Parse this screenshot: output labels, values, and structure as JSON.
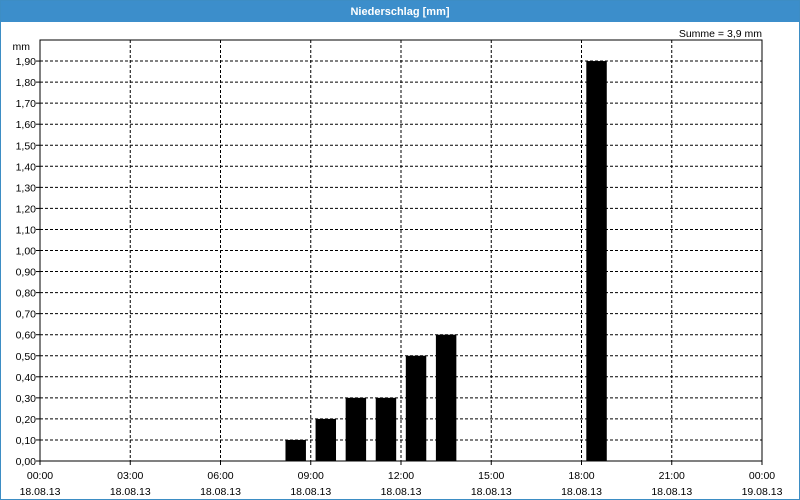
{
  "window": {
    "title": "Niederschlag [mm]"
  },
  "chart_data": {
    "type": "bar",
    "title": "Niederschlag [mm]",
    "ylabel": "mm",
    "annotation": "Summe = 3,9 mm",
    "ylim": [
      0,
      2.0
    ],
    "y_ticks": [
      "0,00",
      "0,10",
      "0,20",
      "0,30",
      "0,40",
      "0,50",
      "0,60",
      "0,70",
      "0,80",
      "0,90",
      "1,00",
      "1,10",
      "1,20",
      "1,30",
      "1,40",
      "1,50",
      "1,60",
      "1,70",
      "1,80",
      "1,90"
    ],
    "xlim_hours": [
      0,
      24
    ],
    "x_ticks": [
      {
        "time": "00:00",
        "date": "18.08.13"
      },
      {
        "time": "03:00",
        "date": "18.08.13"
      },
      {
        "time": "06:00",
        "date": "18.08.13"
      },
      {
        "time": "09:00",
        "date": "18.08.13"
      },
      {
        "time": "12:00",
        "date": "18.08.13"
      },
      {
        "time": "15:00",
        "date": "18.08.13"
      },
      {
        "time": "18:00",
        "date": "18.08.13"
      },
      {
        "time": "21:00",
        "date": "18.08.13"
      },
      {
        "time": "00:00",
        "date": "19.08.13"
      }
    ],
    "bars": [
      {
        "hour": 8,
        "value": 0.1
      },
      {
        "hour": 9,
        "value": 0.2
      },
      {
        "hour": 10,
        "value": 0.3
      },
      {
        "hour": 11,
        "value": 0.3
      },
      {
        "hour": 12,
        "value": 0.5
      },
      {
        "hour": 13,
        "value": 0.6
      },
      {
        "hour": 18,
        "value": 1.9
      }
    ],
    "bar_color": "#000000",
    "grid": true
  }
}
